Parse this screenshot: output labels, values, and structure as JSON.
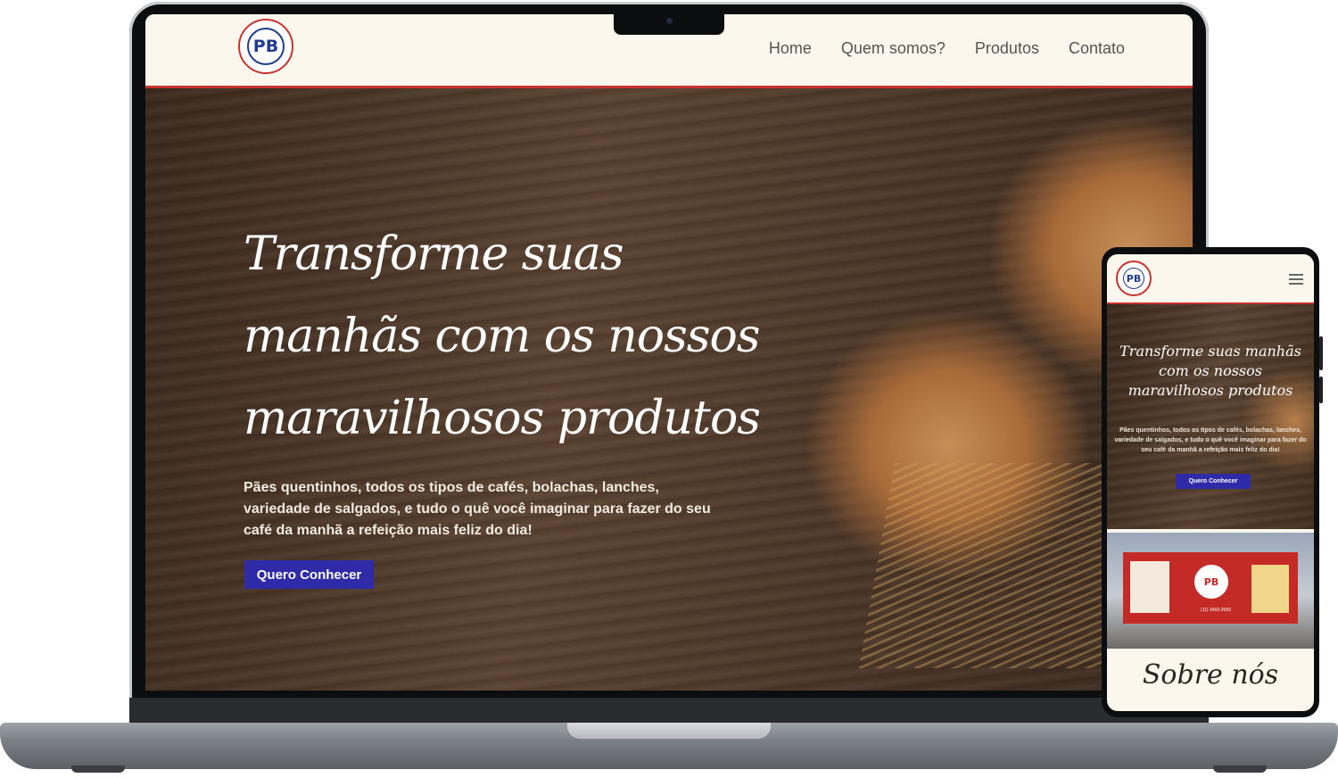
{
  "desktop": {
    "logo_text": "PB",
    "nav": [
      "Home",
      "Quem somos?",
      "Produtos",
      "Contato"
    ],
    "hero": {
      "title": "Transforme suas manhãs com os nossos maravilhosos produtos",
      "text": "Pães quentinhos, todos os tipos de cafés, bolachas, lanches, variedade de salgados, e tudo o quê você imaginar para fazer do seu café da manhã a refeição mais feliz do dia!",
      "cta_label": "Quero Conhecer"
    }
  },
  "mobile": {
    "logo_text": "PB",
    "hero": {
      "title": "Transforme suas manhãs com os nossos maravilhosos produtos",
      "text": "Pães quentinhos, todos os tipos de cafés, bolachas, lanches, variedade de salgados, e tudo o quê você imaginar para fazer do seu café da manhã a refeição mais feliz do dia!",
      "cta_label": "Quero Conhecer"
    },
    "storefront_logo_text": "PB",
    "storefront_phone_text": "(11) 3493-2083",
    "about_heading": "Sobre nós"
  },
  "colors": {
    "accent_red": "#c8332e",
    "button_blue": "#2f2ba8",
    "header_bg": "#fbf7ec",
    "logo_blue": "#233b8c"
  },
  "icons": [
    "pb-logo",
    "hamburger-menu-icon",
    "camera-icon"
  ]
}
